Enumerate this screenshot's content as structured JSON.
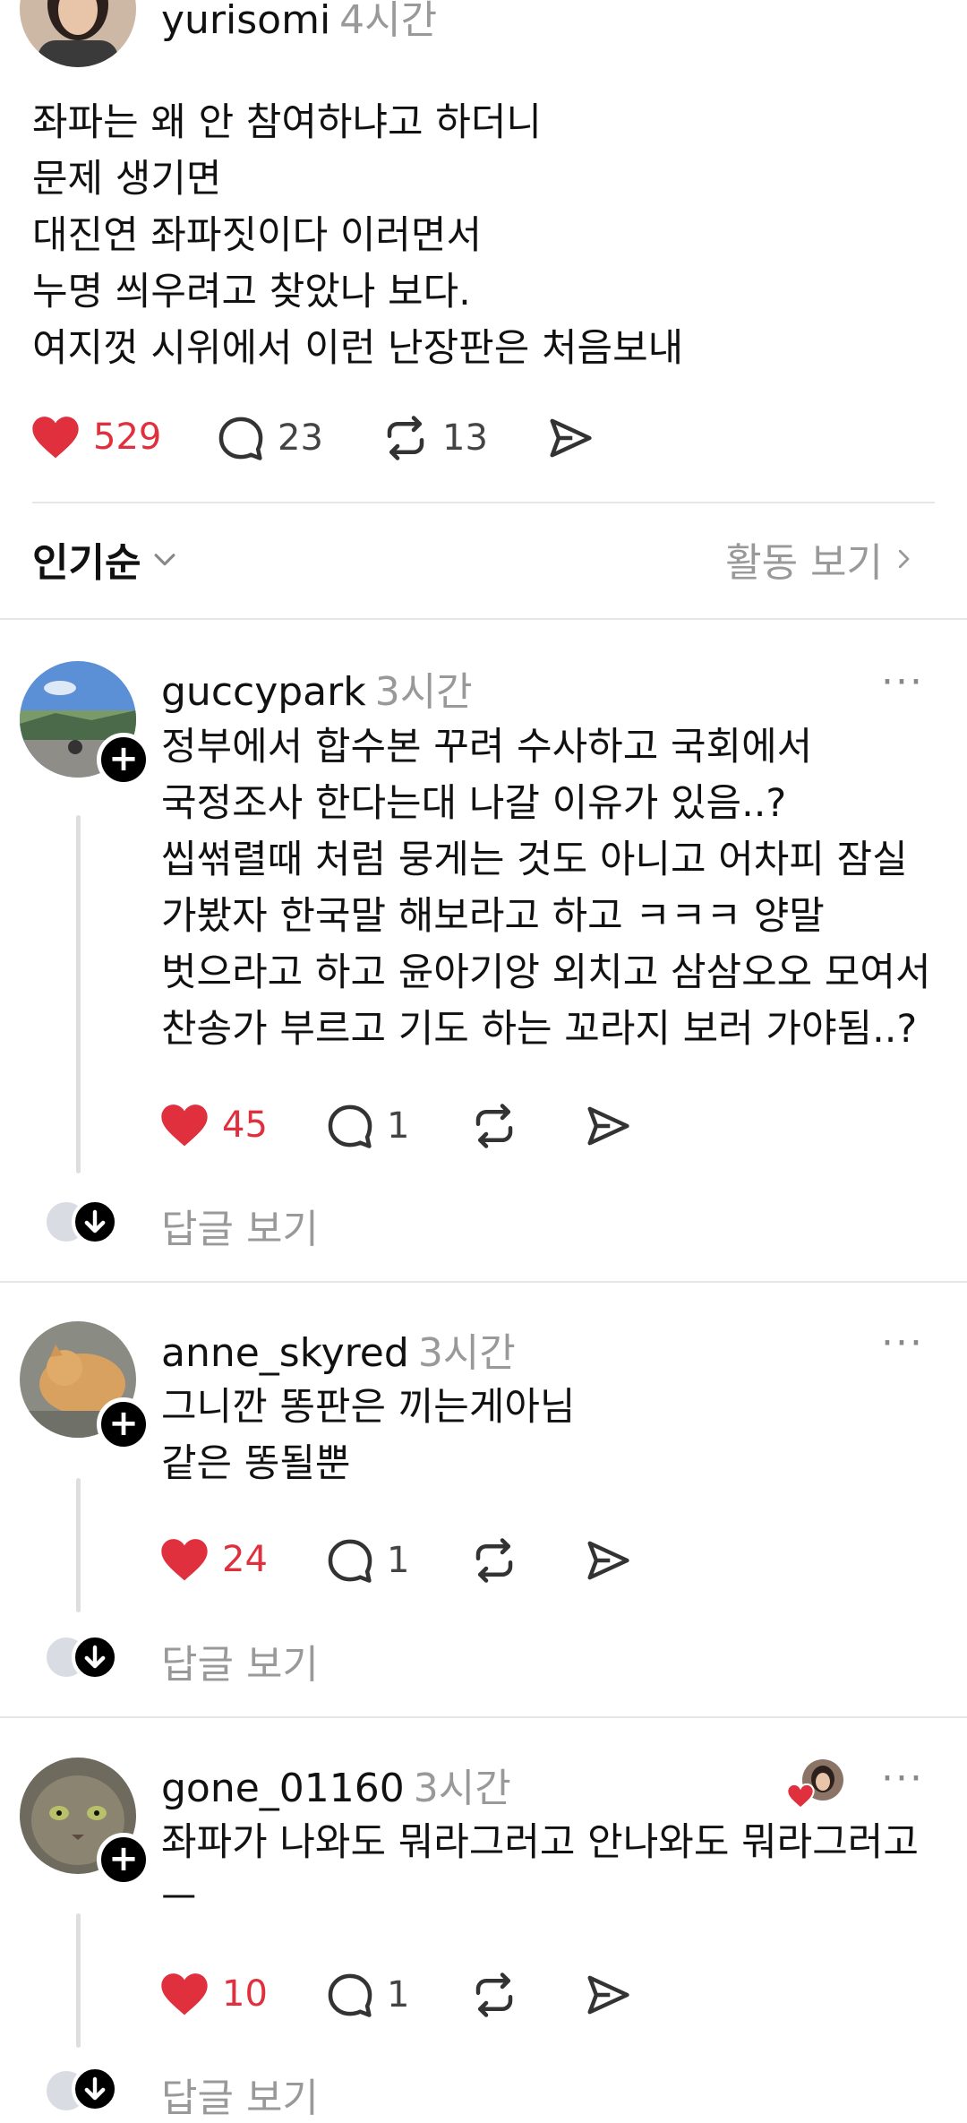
{
  "post": {
    "username": "yurisomi",
    "time": "4시간",
    "lines": [
      "좌파는 왜 안 참여하냐고 하더니",
      "문제 생기면",
      "대진연 좌파짓이다 이러면서",
      "누명 씌우려고 찾았나 보다.",
      "여지껏 시위에서 이런 난장판은 처음보내"
    ],
    "likes": "529",
    "comments": "23",
    "reposts": "13"
  },
  "sort": {
    "label": "인기순",
    "activity_label": "활동 보기"
  },
  "replies": [
    {
      "username": "guccypark",
      "time": "3시간",
      "lines": [
        "정부에서 합수본 꾸려 수사하고 국회에서",
        "국정조사 한다는대 나갈 이유가 있음..?",
        "씹썪렬때 처럼 뭉게는 것도 아니고 어차피 잠실",
        "가봤자 한국말 해보라고 하고 ㅋㅋㅋ 양말",
        "벗으라고 하고 윤아기앙 외치고 삼삼오오 모여서",
        "찬송가 부르고 기도 하는 꼬라지 보러 가야됨..?"
      ],
      "likes": "45",
      "comments": "1",
      "view_replies": "답글 보기"
    },
    {
      "username": "anne_skyred",
      "time": "3시간",
      "lines": [
        "그니깐 똥판은 끼는게아님",
        "같은 똥될뿐"
      ],
      "likes": "24",
      "comments": "1",
      "view_replies": "답글 보기"
    },
    {
      "username": "gone_01160",
      "time": "3시간",
      "lines": [
        "좌파가 나와도 뭐라그러고 안나와도 뭐라그러고",
        "ㅡ"
      ],
      "likes": "10",
      "comments": "1",
      "view_replies": "답글 보기"
    }
  ],
  "colors": {
    "like_red": "#e0303d",
    "muted_gray": "#999999",
    "divider": "#e6e6e6"
  },
  "icons": [
    "heart-icon",
    "comment-icon",
    "repost-icon",
    "share-icon",
    "more-icon",
    "follow-plus-icon",
    "chevron-down-icon",
    "chevron-right-icon"
  ]
}
